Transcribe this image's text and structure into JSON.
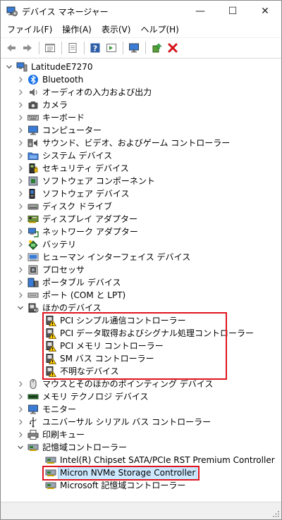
{
  "window": {
    "title": "デバイス マネージャー",
    "minimize": "—",
    "maximize": "☐",
    "close": "✕"
  },
  "menu": [
    "ファイル(F)",
    "操作(A)",
    "表示(V)",
    "ヘルプ(H)"
  ],
  "tree": {
    "root": "LatitudeE7270",
    "categories": [
      "Bluetooth",
      "オーディオの入力および出力",
      "カメラ",
      "キーボード",
      "コンピューター",
      "サウンド、ビデオ、およびゲーム コントローラー",
      "システム デバイス",
      "セキュリティ デバイス",
      "ソフトウェア コンポーネント",
      "ソフトウェア デバイス",
      "ディスク ドライブ",
      "ディスプレイ アダプター",
      "ネットワーク アダプター",
      "バッテリ",
      "ヒューマン インターフェイス デバイス",
      "プロセッサ",
      "ポータブル デバイス",
      "ポート (COM と LPT)",
      "ほかのデバイス",
      "マウスとそのほかのポインティング デバイス",
      "メモリ テクノロジ デバイス",
      "モニター",
      "ユニバーサル シリアル バス コントローラー",
      "印刷キュー",
      "記憶域コントローラー"
    ],
    "other_devices": [
      "PCI シンプル通信コントローラー",
      "PCI データ取得およびシグナル処理コントローラー",
      "PCI メモリ コントローラー",
      "SM バス コントローラー",
      "不明なデバイス"
    ],
    "storage_controllers": [
      "Intel(R) Chipset SATA/PCIe RST Premium Controller",
      "Micron NVMe Storage Controller",
      "Microsoft 記憶域コントローラー"
    ]
  },
  "colors": {
    "selection": "#cce8ff",
    "highlight_box": "#e0141e",
    "warning": "#f5c400"
  }
}
